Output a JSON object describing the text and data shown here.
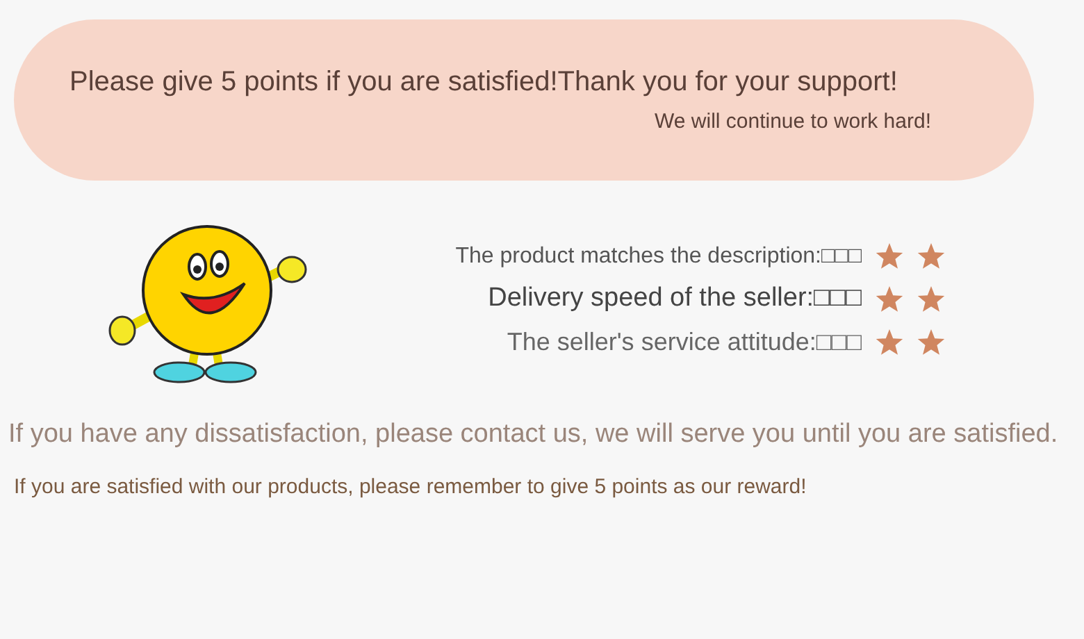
{
  "banner": {
    "headline": "Please give 5 points if you are satisfied!Thank you for your support!",
    "subline": "We will continue to work hard!"
  },
  "ratings": [
    {
      "label": "The product matches the description:□□□"
    },
    {
      "label": "Delivery speed of the seller:□□□"
    },
    {
      "label": "The seller's service attitude:□□□"
    }
  ],
  "notes": [
    "If you have any dissatisfaction, please contact us, we will serve you until you are satisfied.",
    "If you are satisfied with our products, please remember to give 5 points as our reward!"
  ]
}
